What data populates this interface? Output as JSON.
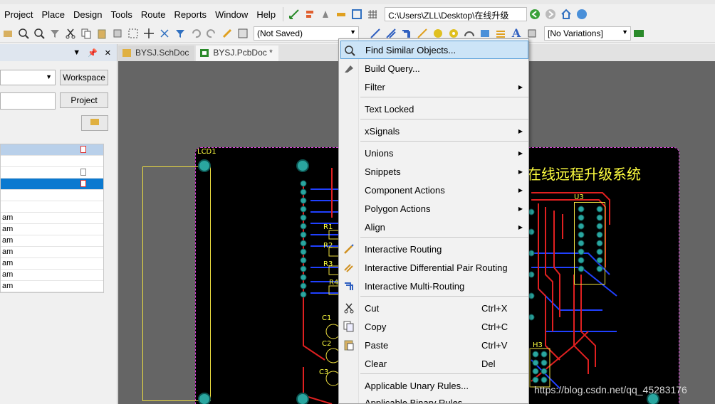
{
  "menubar": {
    "items": [
      "Project",
      "Place",
      "Design",
      "Tools",
      "Route",
      "Reports",
      "Window",
      "Help"
    ],
    "path": "C:\\Users\\ZLL\\Desktop\\在线升级"
  },
  "toolbar2": {
    "doc_state": "(Not Saved)",
    "variations": "[No Variations]"
  },
  "left_panel": {
    "workspace_button": "Workspace",
    "project_button": "Project",
    "tree_rows": [
      "",
      "",
      "",
      "",
      "",
      "am",
      "am",
      "am",
      "am",
      "am",
      "am",
      "am",
      ""
    ]
  },
  "tabs": [
    {
      "label": "BYSJ.SchDoc",
      "active": false
    },
    {
      "label": "BYSJ.PcbDoc *",
      "active": true
    }
  ],
  "board": {
    "title": "在线远程升级系统",
    "designators": [
      "LCD1",
      "R1",
      "R2",
      "R3",
      "R4",
      "C1",
      "C2",
      "C3",
      "U3",
      "H3"
    ]
  },
  "context_menu": {
    "items": [
      {
        "label": "Find Similar Objects...",
        "highlighted": true,
        "icon": "find-similar-icon"
      },
      {
        "label": "Build Query...",
        "icon": "build-query-icon"
      },
      {
        "label": "Filter",
        "submenu": true
      },
      {
        "label": "Text Locked"
      },
      {
        "label": "xSignals",
        "submenu": true
      },
      {
        "label": "Unions",
        "submenu": true
      },
      {
        "label": "Snippets",
        "submenu": true
      },
      {
        "label": "Component Actions",
        "submenu": true
      },
      {
        "label": "Polygon Actions",
        "submenu": true
      },
      {
        "label": "Align",
        "submenu": true
      },
      {
        "label": "Interactive Routing",
        "icon": "interactive-routing-icon"
      },
      {
        "label": "Interactive Differential Pair Routing",
        "icon": "diff-pair-routing-icon"
      },
      {
        "label": "Interactive Multi-Routing",
        "icon": "multi-routing-icon"
      },
      {
        "label": "Cut",
        "shortcut": "Ctrl+X",
        "icon": "scissors-icon"
      },
      {
        "label": "Copy",
        "shortcut": "Ctrl+C",
        "icon": "copy-icon"
      },
      {
        "label": "Paste",
        "shortcut": "Ctrl+V",
        "icon": "paste-icon"
      },
      {
        "label": "Clear",
        "shortcut": "Del"
      },
      {
        "label": "Applicable Unary Rules..."
      },
      {
        "label": "Applicable Binary Rules..."
      }
    ]
  },
  "watermark": "https://blog.csdn.net/qq_45283176",
  "colors": {
    "highlight": "#cce4f7",
    "board_bg": "#000000",
    "silkscreen": "#ffff40",
    "top_layer": "#e02020",
    "bottom_layer": "#2040ff",
    "canvas_bg": "#656565"
  }
}
